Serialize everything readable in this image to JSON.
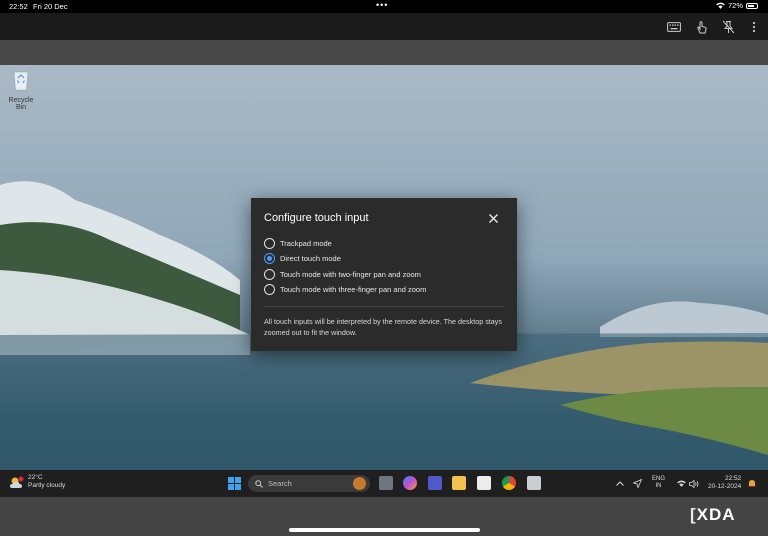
{
  "status_bar": {
    "time": "22:52",
    "date": "Fri 20 Dec",
    "more_dots": "•••",
    "battery": "72%"
  },
  "toolbar": {
    "icons": [
      "keyboard-icon",
      "touch-icon",
      "pin-off-icon",
      "more-vertical-icon"
    ]
  },
  "desktop": {
    "recycle_bin_label": "Recycle Bin"
  },
  "dialog": {
    "title": "Configure touch input",
    "options": [
      {
        "label": "Trackpad mode",
        "selected": false
      },
      {
        "label": "Direct touch mode",
        "selected": true
      },
      {
        "label": "Touch mode with two-finger pan and zoom",
        "selected": false
      },
      {
        "label": "Touch mode with three-finger pan and zoom",
        "selected": false
      }
    ],
    "description": "All touch inputs will be interpreted by the remote device. The desktop stays zoomed out to fit the window."
  },
  "taskbar": {
    "weather_temp": "22°C",
    "weather_desc": "Partly cloudy",
    "search_placeholder": "Search",
    "lang_top": "ENG",
    "lang_bottom": "IN",
    "clock_time": "22:52",
    "clock_date": "20-12-2024"
  },
  "watermark": {
    "brand": "XDA"
  },
  "colors": {
    "accent": "#4a9bff",
    "dialog_bg": "#2b2b2b",
    "taskbar_bg": "#1f1f1f"
  }
}
